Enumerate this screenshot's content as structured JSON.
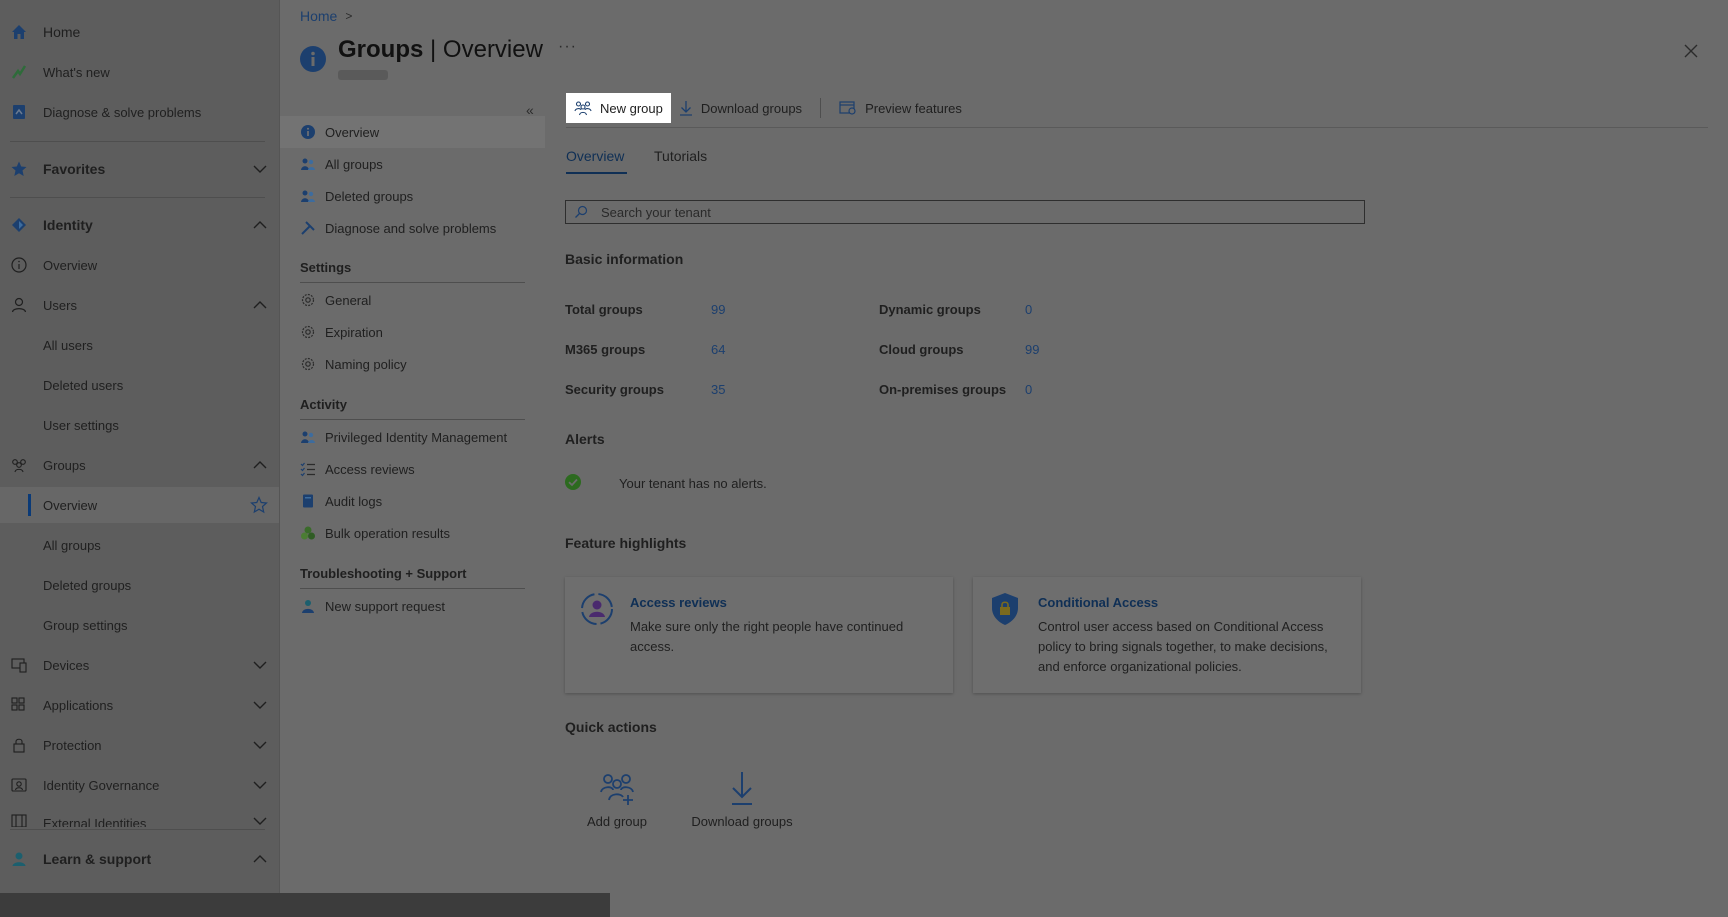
{
  "leftnav": {
    "home": "Home",
    "whats_new": "What's new",
    "diagnose": "Diagnose & solve problems",
    "favorites": "Favorites",
    "identity": "Identity",
    "overview": "Overview",
    "users": "Users",
    "all_users": "All users",
    "deleted_users": "Deleted users",
    "user_settings": "User settings",
    "groups": "Groups",
    "groups_overview": "Overview",
    "all_groups": "All groups",
    "deleted_groups": "Deleted groups",
    "group_settings": "Group settings",
    "devices": "Devices",
    "applications": "Applications",
    "protection": "Protection",
    "identity_governance": "Identity Governance",
    "external_identities": "External Identities",
    "learn_support": "Learn & support"
  },
  "header": {
    "breadcrumb_home": "Home",
    "breadcrumb_sep": ">",
    "title_main": "Groups",
    "title_sep": " | ",
    "title_sub": "Overview",
    "more": "···"
  },
  "section_menu": {
    "collapse": "«",
    "overview": "Overview",
    "all_groups": "All groups",
    "deleted_groups": "Deleted groups",
    "diagnose": "Diagnose and solve problems",
    "settings_head": "Settings",
    "general": "General",
    "expiration": "Expiration",
    "naming_policy": "Naming policy",
    "activity_head": "Activity",
    "pim": "Privileged Identity Management",
    "access_reviews": "Access reviews",
    "audit_logs": "Audit logs",
    "bulk_results": "Bulk operation results",
    "support_head": "Troubleshooting + Support",
    "new_support": "New support request"
  },
  "toolbar": {
    "new_group": "New group",
    "download_groups": "Download groups",
    "preview_features": "Preview features"
  },
  "tabs": {
    "overview": "Overview",
    "tutorials": "Tutorials"
  },
  "search": {
    "placeholder": "Search your tenant"
  },
  "basic_info": {
    "heading": "Basic information",
    "total_groups_label": "Total groups",
    "total_groups": "99",
    "m365_label": "M365 groups",
    "m365": "64",
    "security_label": "Security groups",
    "security": "35",
    "dynamic_label": "Dynamic groups",
    "dynamic": "0",
    "cloud_label": "Cloud groups",
    "cloud": "99",
    "onprem_label": "On-premises groups",
    "onprem": "0"
  },
  "alerts": {
    "heading": "Alerts",
    "text": "Your tenant has no alerts."
  },
  "features": {
    "heading": "Feature highlights",
    "access_reviews_title": "Access reviews",
    "access_reviews_desc": "Make sure only the right people have continued access.",
    "ca_title": "Conditional Access",
    "ca_desc": "Control user access based on Conditional Access policy to bring signals together, to make decisions, and enforce organizational policies."
  },
  "quick_actions": {
    "heading": "Quick actions",
    "add_group": "Add group",
    "download_groups": "Download groups"
  },
  "colors": {
    "accent": "#1c3f6e",
    "link": "#0f2f55",
    "highlight": "#ffffff"
  }
}
